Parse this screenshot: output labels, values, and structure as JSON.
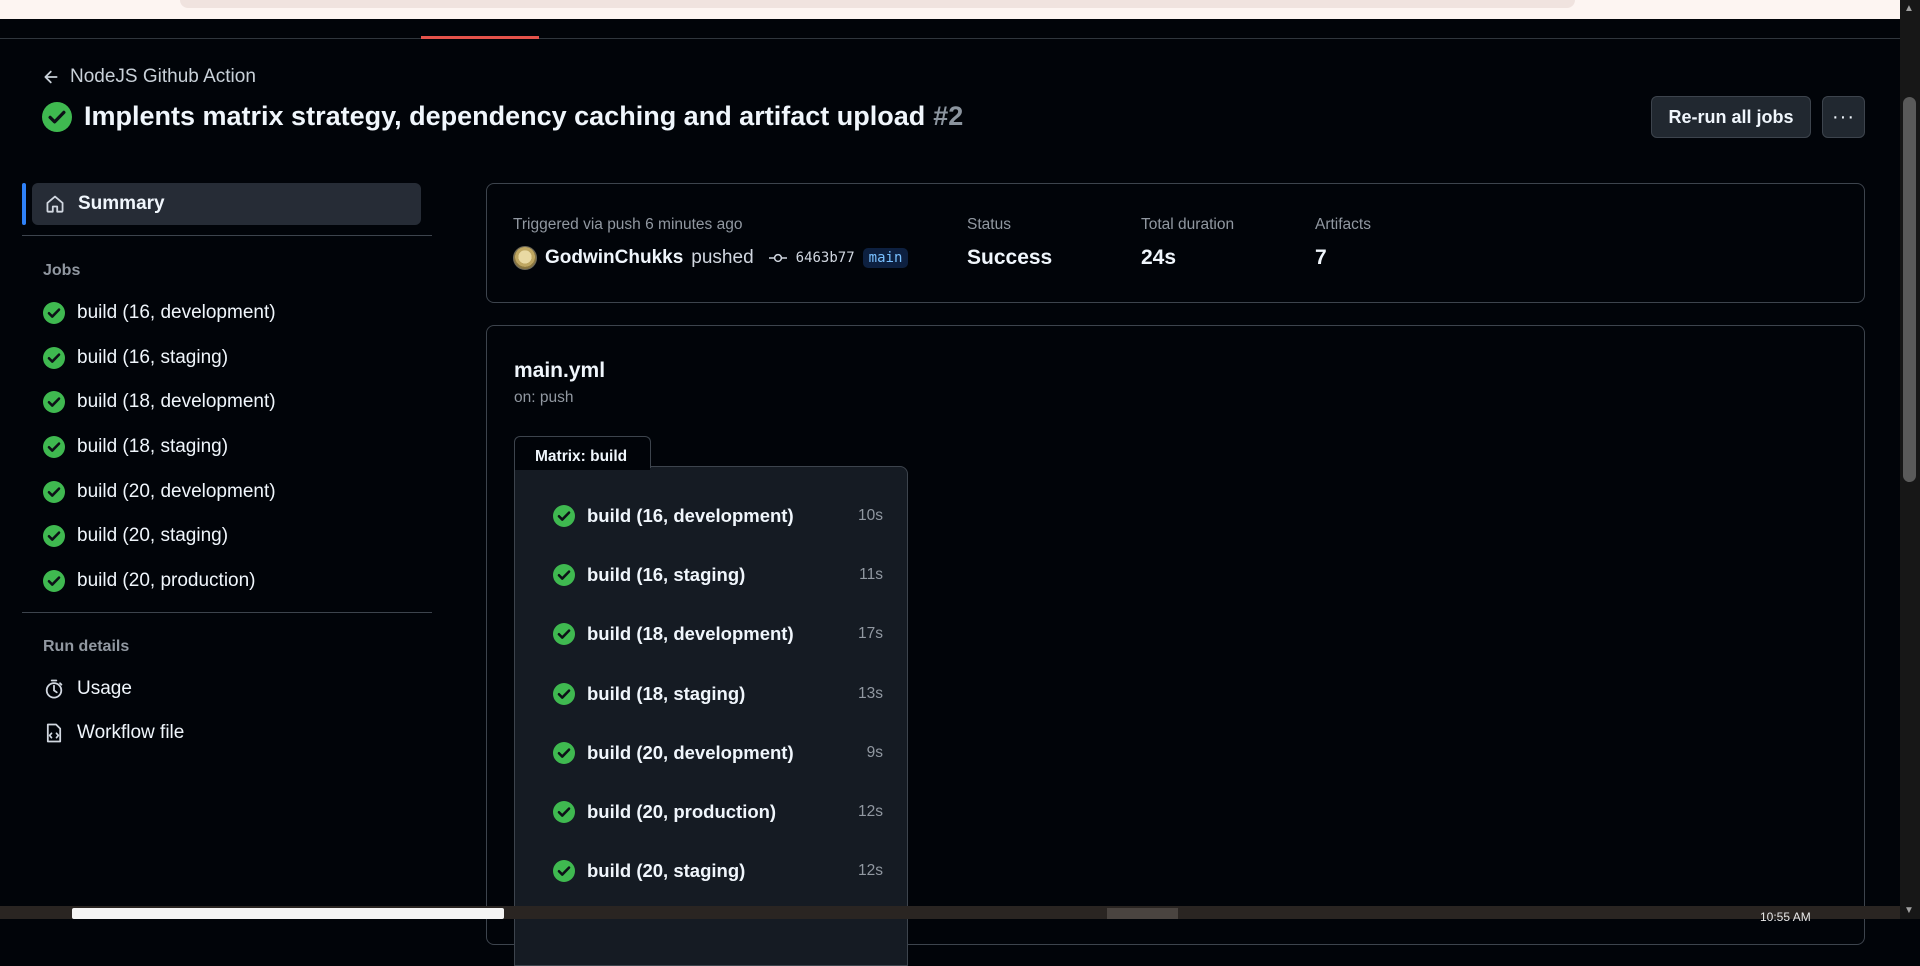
{
  "navigation": {
    "back_label": "NodeJS Github Action"
  },
  "run": {
    "title": "Implents matrix strategy, dependency caching and artifact upload",
    "number": "#2"
  },
  "actions": {
    "rerun_label": "Re-run all jobs",
    "more_label": "···"
  },
  "sidebar": {
    "summary_label": "Summary",
    "jobs_heading": "Jobs",
    "jobs": [
      "build (16, development)",
      "build (16, staging)",
      "build (18, development)",
      "build (18, staging)",
      "build (20, development)",
      "build (20, staging)",
      "build (20, production)"
    ],
    "run_details_heading": "Run details",
    "usage_label": "Usage",
    "workflow_file_label": "Workflow file"
  },
  "summary": {
    "trigger_text": "Triggered via push 6 minutes ago",
    "actor": "GodwinChukks",
    "action": "pushed",
    "commit_sha": "6463b77",
    "branch": "main",
    "status_label": "Status",
    "status_value": "Success",
    "duration_label": "Total duration",
    "duration_value": "24s",
    "artifacts_label": "Artifacts",
    "artifacts_value": "7"
  },
  "workflow": {
    "file_name": "main.yml",
    "trigger": "on: push",
    "matrix_label": "Matrix: build",
    "matrix_jobs": [
      {
        "name": "build (16, development)",
        "duration": "10s"
      },
      {
        "name": "build (16, staging)",
        "duration": "11s"
      },
      {
        "name": "build (18, development)",
        "duration": "17s"
      },
      {
        "name": "build (18, staging)",
        "duration": "13s"
      },
      {
        "name": "build (20, development)",
        "duration": "9s"
      },
      {
        "name": "build (20, production)",
        "duration": "12s"
      },
      {
        "name": "build (20, staging)",
        "duration": "12s"
      }
    ]
  },
  "taskbar": {
    "clock": "10:55 AM"
  },
  "colors": {
    "success": "#3fb950",
    "accent_blue": "#2f81f7",
    "background": "#010409",
    "panel": "#151b23"
  }
}
